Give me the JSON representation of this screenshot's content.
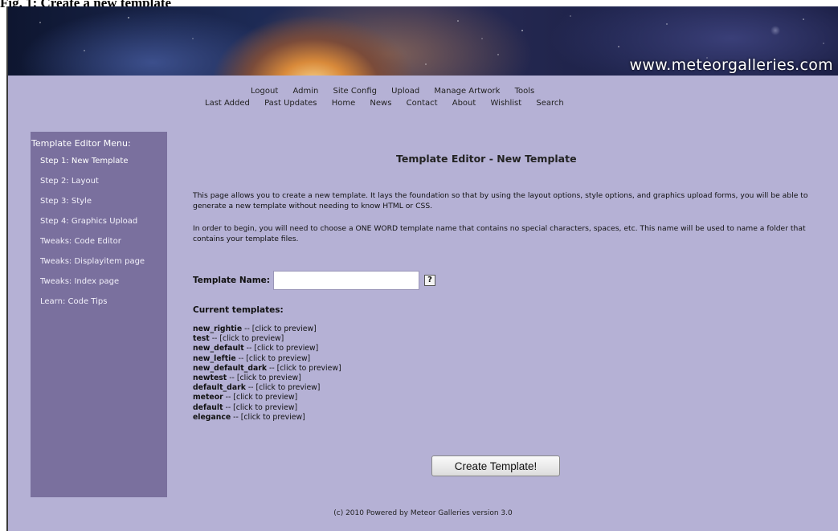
{
  "caption": "Fig. 1: Create a new template",
  "banner": {
    "site_url": "www.meteorgalleries.com"
  },
  "nav": {
    "row1": [
      "Logout",
      "Admin",
      "Site Config",
      "Upload",
      "Manage Artwork",
      "Tools"
    ],
    "row2": [
      "Last Added",
      "Past Updates",
      "Home",
      "News",
      "Contact",
      "About",
      "Wishlist",
      "Search"
    ]
  },
  "sidebar": {
    "title": "Template Editor Menu:",
    "items": [
      "Step 1: New Template",
      "Step 2: Layout",
      "Step 3: Style",
      "Step 4: Graphics Upload",
      "Tweaks: Code Editor",
      "Tweaks: Displayitem page",
      "Tweaks: Index page",
      "Learn: Code Tips"
    ]
  },
  "main": {
    "heading": "Template Editor - New Template",
    "intro1": "This page allows you to create a new template. It lays the foundation so that by using the layout options, style options, and graphics upload forms, you will be able to generate a new template without needing to know HTML or CSS.",
    "intro2": "In order to begin, you will need to choose a ONE WORD template name that contains no special characters, spaces, etc. This name will be used to name a folder that contains your template files.",
    "name_label": "Template Name:",
    "name_value": "",
    "help_label": "?",
    "templates_heading": "Current templates:",
    "templates": [
      {
        "name": "new_rightie",
        "preview": " -- [click to preview]"
      },
      {
        "name": "test",
        "preview": " -- [click to preview]"
      },
      {
        "name": "new_default",
        "preview": " -- [click to preview]"
      },
      {
        "name": "new_leftie",
        "preview": " -- [click to preview]"
      },
      {
        "name": "new_default_dark",
        "preview": " -- [click to preview]"
      },
      {
        "name": "newtest",
        "preview": " -- [click to preview]"
      },
      {
        "name": "default_dark",
        "preview": " -- [click to preview]"
      },
      {
        "name": "meteor",
        "preview": " -- [click to preview]"
      },
      {
        "name": "default",
        "preview": " -- [click to preview]"
      },
      {
        "name": "elegance",
        "preview": " -- [click to preview]"
      }
    ],
    "create_button": "Create Template!"
  },
  "footer": "(c) 2010 Powered by Meteor Galleries version 3.0",
  "colors": {
    "content_bg": "#b5b1d5",
    "sidebar_bg": "#7a709e"
  }
}
